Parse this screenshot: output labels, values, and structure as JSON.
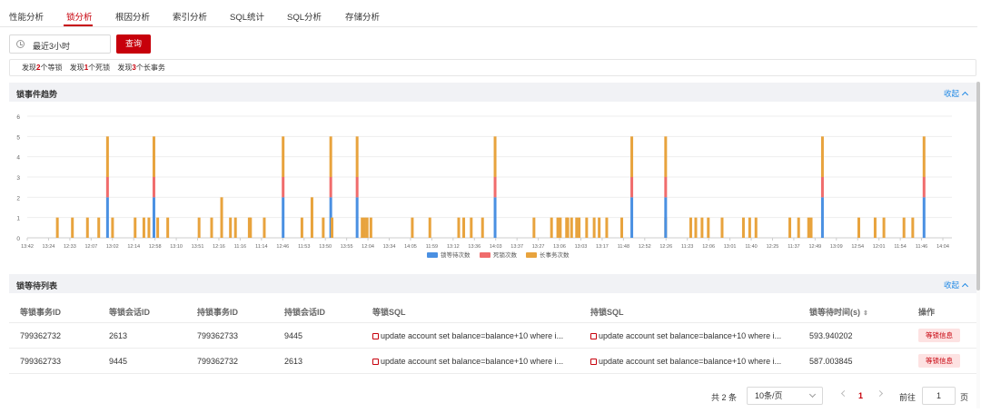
{
  "tabs": [
    {
      "label": "性能分析",
      "active": false
    },
    {
      "label": "锁分析",
      "active": true
    },
    {
      "label": "根因分析",
      "active": false
    },
    {
      "label": "索引分析",
      "active": false
    },
    {
      "label": "SQL统计",
      "active": false
    },
    {
      "label": "SQL分析",
      "active": false
    },
    {
      "label": "存储分析",
      "active": false
    }
  ],
  "filter": {
    "time_range": "最近3小时",
    "query_label": "查询"
  },
  "summary": [
    {
      "prefix": "发现",
      "num": "2",
      "suffix": "个等锁"
    },
    {
      "prefix": "发现",
      "num": "1",
      "suffix": "个死锁"
    },
    {
      "prefix": "发现",
      "num": "3",
      "suffix": "个长事务"
    }
  ],
  "trend_section": {
    "title": "锁事件趋势",
    "collapse_label": "收起"
  },
  "wait_section": {
    "title": "锁等待列表",
    "collapse_label": "收起"
  },
  "colors": {
    "accent": "#c7000b",
    "link": "#1e88e5",
    "lock_wait": "#4a90e2",
    "deadlock": "#f06c6c",
    "long_txn": "#e8a33d"
  },
  "chart_data": {
    "type": "bar",
    "stacked": true,
    "ylim": [
      0,
      6
    ],
    "yticks": [
      "0",
      "1",
      "2",
      "3",
      "4",
      "5",
      "6"
    ],
    "grid": true,
    "legend_position": "bottom-center",
    "xtick_labels": [
      "13:42",
      "13:24",
      "12:33",
      "12:07",
      "13:02",
      "12:14",
      "12:58",
      "13:10",
      "13:51",
      "12:16",
      "11:16",
      "11:14",
      "12:46",
      "11:53",
      "13:50",
      "13:55",
      "12:04",
      "13:34",
      "14:05",
      "11:59",
      "13:12",
      "13:36",
      "14:03",
      "13:37",
      "13:27",
      "13:06",
      "13:03",
      "13:17",
      "11:48",
      "12:52",
      "12:26",
      "11:23",
      "12:06",
      "13:01",
      "11:40",
      "12:25",
      "11:37",
      "12:49",
      "13:09",
      "12:54",
      "12:01",
      "11:54",
      "11:46",
      "14:04"
    ],
    "series": [
      {
        "name": "锁等待次数",
        "color": "#4a90e2",
        "values": [
          0,
          0,
          0,
          0,
          2,
          0,
          0,
          0,
          0,
          2,
          0,
          0,
          0,
          0,
          0,
          0,
          0,
          0,
          0,
          0,
          2,
          0,
          0,
          0,
          2,
          0,
          2,
          0,
          0,
          0,
          0,
          0,
          0,
          0,
          0,
          0,
          0,
          2,
          0,
          0,
          0,
          0,
          0,
          0,
          0,
          0,
          0,
          0,
          0,
          0,
          0,
          0,
          2,
          0,
          2,
          0,
          0,
          0,
          0,
          0,
          0,
          0,
          0,
          0,
          0,
          0,
          0,
          2,
          0,
          0,
          0,
          0,
          0,
          2
        ]
      },
      {
        "name": "死锁次数",
        "color": "#f06c6c",
        "values": [
          0,
          0,
          0,
          0,
          1,
          0,
          0,
          0,
          0,
          1,
          0,
          0,
          0,
          0,
          0,
          0,
          0,
          0,
          0,
          0,
          1,
          0,
          0,
          0,
          1,
          0,
          1,
          0,
          0,
          0,
          0,
          0,
          0,
          0,
          0,
          0,
          0,
          1,
          0,
          0,
          0,
          0,
          0,
          0,
          0,
          0,
          0,
          0,
          0,
          0,
          0,
          0,
          1,
          0,
          1,
          0,
          0,
          0,
          0,
          0,
          0,
          0,
          0,
          0,
          0,
          0,
          0,
          1,
          0,
          0,
          0,
          0,
          0,
          1
        ]
      },
      {
        "name": "长事务次数",
        "color": "#e8a33d",
        "values": [
          1,
          1,
          1,
          1,
          2,
          1,
          1,
          1,
          1,
          2,
          1,
          1,
          1,
          1,
          2,
          1,
          1,
          1,
          1,
          1,
          2,
          1,
          2,
          1,
          2,
          1,
          2,
          1,
          1,
          1,
          1,
          1,
          1,
          1,
          1,
          1,
          1,
          2,
          1,
          1,
          1,
          1,
          1,
          1,
          1,
          1,
          1,
          1,
          1,
          1,
          1,
          1,
          2,
          1,
          2,
          1,
          1,
          1,
          1,
          1,
          1,
          1,
          1,
          1,
          1,
          1,
          1,
          2,
          1,
          1,
          1,
          1,
          1,
          2
        ]
      }
    ],
    "bar_slots": [
      2.4,
      3.6,
      4.8,
      5.7,
      6.4,
      6.8,
      8.6,
      9.3,
      9.7,
      10.1,
      10.4,
      11.2,
      13.7,
      14.7,
      15.5,
      16.2,
      16.6,
      17.7,
      17.8,
      18.9,
      20.4,
      21.9,
      22.7,
      23.6,
      24.2,
      24.3,
      26.3,
      26.7,
      26.9,
      27.1,
      27.4,
      30.7,
      32.1,
      34.4,
      34.8,
      35.4,
      36.3,
      37.3,
      40.4,
      41.8,
      42.3,
      42.5,
      43.0,
      43.1,
      43.4,
      43.8,
      44.0,
      44.6,
      45.2,
      45.6,
      46.2,
      47.4,
      48.2,
      50.9,
      50.9,
      52.9,
      53.3,
      53.8,
      54.3,
      55.4,
      57.1,
      57.6,
      58.1,
      60.8,
      61.5,
      62.3,
      62.5,
      63.4,
      66.3,
      67.6,
      68.3,
      69.9,
      70.6,
      71.5
    ]
  },
  "table": {
    "columns": [
      "等锁事务ID",
      "等锁会话ID",
      "持锁事务ID",
      "持锁会话ID",
      "等锁SQL",
      "持锁SQL",
      "锁等待时间(s)",
      "操作"
    ],
    "rows": [
      {
        "wait_trx": "799362732",
        "wait_session": "2613",
        "hold_trx": "799362733",
        "hold_session": "9445",
        "wait_sql": "update account set balance=balance+10 where i...",
        "hold_sql": "update account set balance=balance+10 where i...",
        "wait_time": "593.940202",
        "action": "等锁信息"
      },
      {
        "wait_trx": "799362733",
        "wait_session": "9445",
        "hold_trx": "799362732",
        "hold_session": "2613",
        "wait_sql": "update account set balance=balance+10 where i...",
        "hold_sql": "update account set balance=balance+10 where i...",
        "wait_time": "587.003845",
        "action": "等锁信息"
      }
    ]
  },
  "pagination": {
    "total_label": "共 2 条",
    "page_size": "10条/页",
    "current_page": "1",
    "goto_label": "前往",
    "goto_value": "1",
    "page_suffix": "页"
  }
}
